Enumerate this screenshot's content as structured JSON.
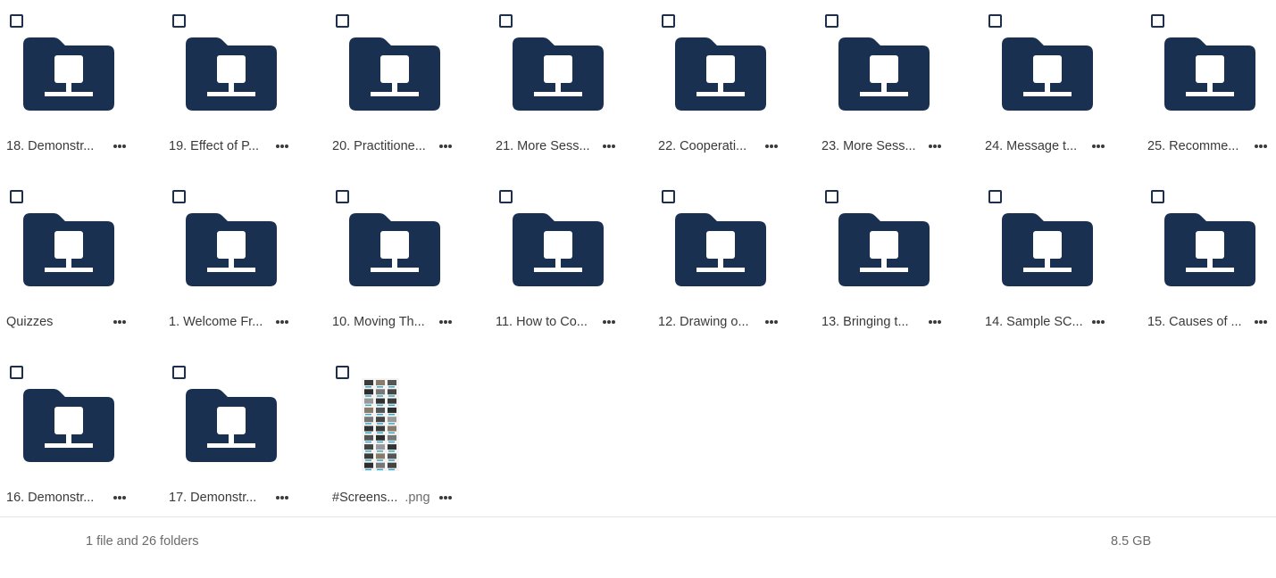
{
  "colors": {
    "folder": "#1a3050",
    "checkbox_border": "#1e2f4d",
    "text": "#3a3a3a",
    "muted": "#6b6b6b"
  },
  "items": [
    {
      "type": "folder",
      "icon": "network-folder-icon",
      "name": "18. Demonstr..."
    },
    {
      "type": "folder",
      "icon": "network-folder-icon",
      "name": "19. Effect of P..."
    },
    {
      "type": "folder",
      "icon": "network-folder-icon",
      "name": "20. Practitione..."
    },
    {
      "type": "folder",
      "icon": "network-folder-icon",
      "name": "21. More Sess..."
    },
    {
      "type": "folder",
      "icon": "network-folder-icon",
      "name": "22. Cooperati..."
    },
    {
      "type": "folder",
      "icon": "network-folder-icon",
      "name": "23. More Sess..."
    },
    {
      "type": "folder",
      "icon": "network-folder-icon",
      "name": "24. Message t..."
    },
    {
      "type": "folder",
      "icon": "network-folder-icon",
      "name": "25. Recomme..."
    },
    {
      "type": "folder",
      "icon": "network-folder-icon",
      "name": "Quizzes"
    },
    {
      "type": "folder",
      "icon": "network-folder-icon",
      "name": "1. Welcome Fr..."
    },
    {
      "type": "folder",
      "icon": "network-folder-icon",
      "name": "10. Moving Th..."
    },
    {
      "type": "folder",
      "icon": "network-folder-icon",
      "name": "11. How to Co..."
    },
    {
      "type": "folder",
      "icon": "network-folder-icon",
      "name": "12. Drawing o..."
    },
    {
      "type": "folder",
      "icon": "network-folder-icon",
      "name": "13. Bringing t..."
    },
    {
      "type": "folder",
      "icon": "network-folder-icon",
      "name": "14. Sample SC..."
    },
    {
      "type": "folder",
      "icon": "network-folder-icon",
      "name": "15. Causes of ..."
    },
    {
      "type": "folder",
      "icon": "network-folder-icon",
      "name": "16. Demonstr..."
    },
    {
      "type": "folder",
      "icon": "network-folder-icon",
      "name": "17. Demonstr..."
    },
    {
      "type": "file",
      "icon": "image-thumbnail",
      "name": "#Screens...",
      "ext": ".png"
    }
  ],
  "footer": {
    "summary": "1 file and 26 folders",
    "size": "8.5 GB"
  }
}
